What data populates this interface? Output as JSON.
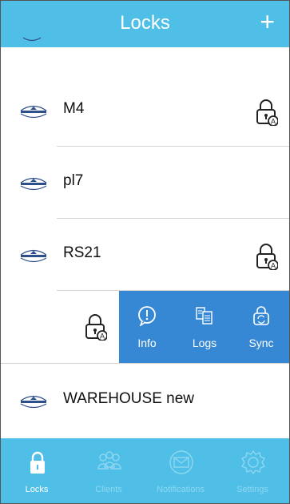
{
  "header": {
    "title": "Locks",
    "add_symbol": "+"
  },
  "locks": [
    {
      "name": "M4",
      "has_lock_icon": true
    },
    {
      "name": "pl7",
      "has_lock_icon": false
    },
    {
      "name": "RS21",
      "has_lock_icon": true
    },
    {
      "name": "WAREHOUSE new",
      "has_lock_icon": false
    }
  ],
  "swipe_actions": [
    {
      "label": "Info",
      "icon": "info-bubble-icon"
    },
    {
      "label": "Logs",
      "icon": "logs-icon"
    },
    {
      "label": "Sync",
      "icon": "sync-lock-icon"
    }
  ],
  "tabs": [
    {
      "label": "Locks",
      "icon": "lock-icon",
      "active": true
    },
    {
      "label": "Clients",
      "icon": "clients-icon",
      "active": false
    },
    {
      "label": "Notifications",
      "icon": "envelope-icon",
      "active": false
    },
    {
      "label": "Settings",
      "icon": "gear-icon",
      "active": false
    }
  ],
  "colors": {
    "header": "#4fbfe7",
    "swipe_actions": "#3688d4",
    "tab_inactive": "#8fd7f1"
  }
}
